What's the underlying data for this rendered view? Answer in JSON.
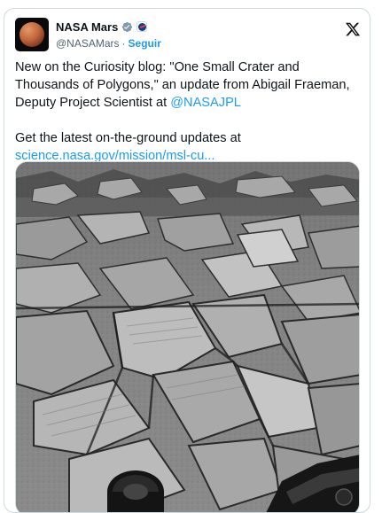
{
  "author": {
    "display_name": "NASA Mars",
    "handle": "@NASAMars",
    "separator": "·",
    "follow_label": "Seguir"
  },
  "icons": {
    "avatar": "mars-planet-avatar",
    "verified": "verified-badge-icon",
    "org_badge": "nasa-logo-icon",
    "platform": "x-logo-icon"
  },
  "tweet": {
    "line1": "New on the Curiosity blog: \"One Small Crater and",
    "line2": "Thousands of Polygons,\" an update from Abigail Fraeman,",
    "line3_prefix": "Deputy Project Scientist at ",
    "mention": "@NASAJPL",
    "line4": "Get the latest on-the-ground updates at",
    "link": "science.nasa.gov/mission/msl-cu..."
  },
  "colors": {
    "link": "#1d9bf0",
    "text": "#0f1419",
    "muted": "#536471",
    "border": "#cfd9de"
  },
  "media": {
    "kind": "grayscale photo of cracked polygonal rock slabs on Mars terrain with rover hardware in lower corners"
  }
}
